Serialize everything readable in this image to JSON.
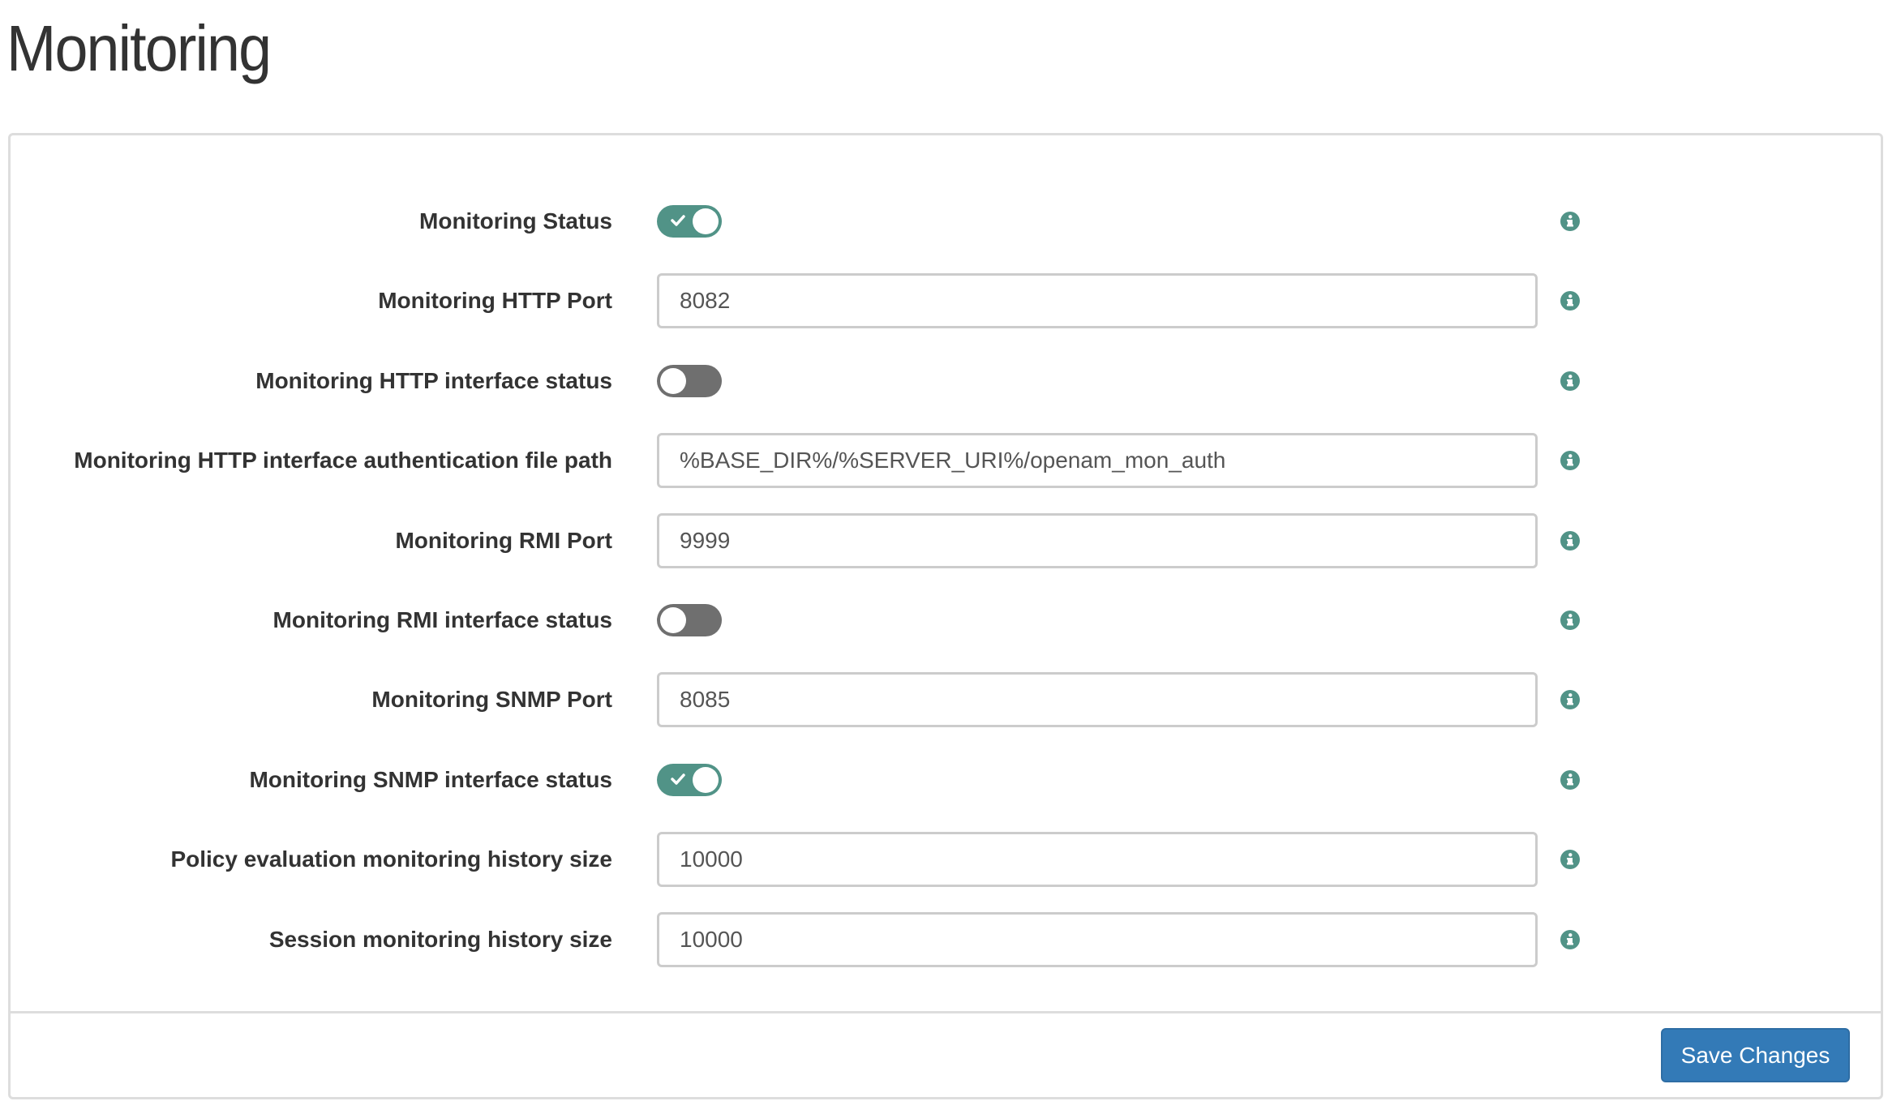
{
  "page": {
    "title": "Monitoring"
  },
  "colors": {
    "accent": "#519387",
    "toggle_off": "#6f6f6f",
    "primary_button": "#337ab7"
  },
  "fields": [
    {
      "label": "Monitoring Status",
      "type": "toggle",
      "checked": true,
      "icon": "info-icon"
    },
    {
      "label": "Monitoring HTTP Port",
      "type": "text",
      "value": "8082",
      "icon": "info-icon"
    },
    {
      "label": "Monitoring HTTP interface status",
      "type": "toggle",
      "checked": false,
      "icon": "info-icon"
    },
    {
      "label": "Monitoring HTTP interface authentication file path",
      "type": "text",
      "value": "%BASE_DIR%/%SERVER_URI%/openam_mon_auth",
      "icon": "info-icon"
    },
    {
      "label": "Monitoring RMI Port",
      "type": "text",
      "value": "9999",
      "icon": "info-icon"
    },
    {
      "label": "Monitoring RMI interface status",
      "type": "toggle",
      "checked": false,
      "icon": "info-icon"
    },
    {
      "label": "Monitoring SNMP Port",
      "type": "text",
      "value": "8085",
      "icon": "info-icon"
    },
    {
      "label": "Monitoring SNMP interface status",
      "type": "toggle",
      "checked": true,
      "icon": "info-icon"
    },
    {
      "label": "Policy evaluation monitoring history size",
      "type": "text",
      "value": "10000",
      "icon": "info-icon"
    },
    {
      "label": "Session monitoring history size",
      "type": "text",
      "value": "10000",
      "icon": "info-icon"
    }
  ],
  "footer": {
    "save_label": "Save Changes"
  }
}
